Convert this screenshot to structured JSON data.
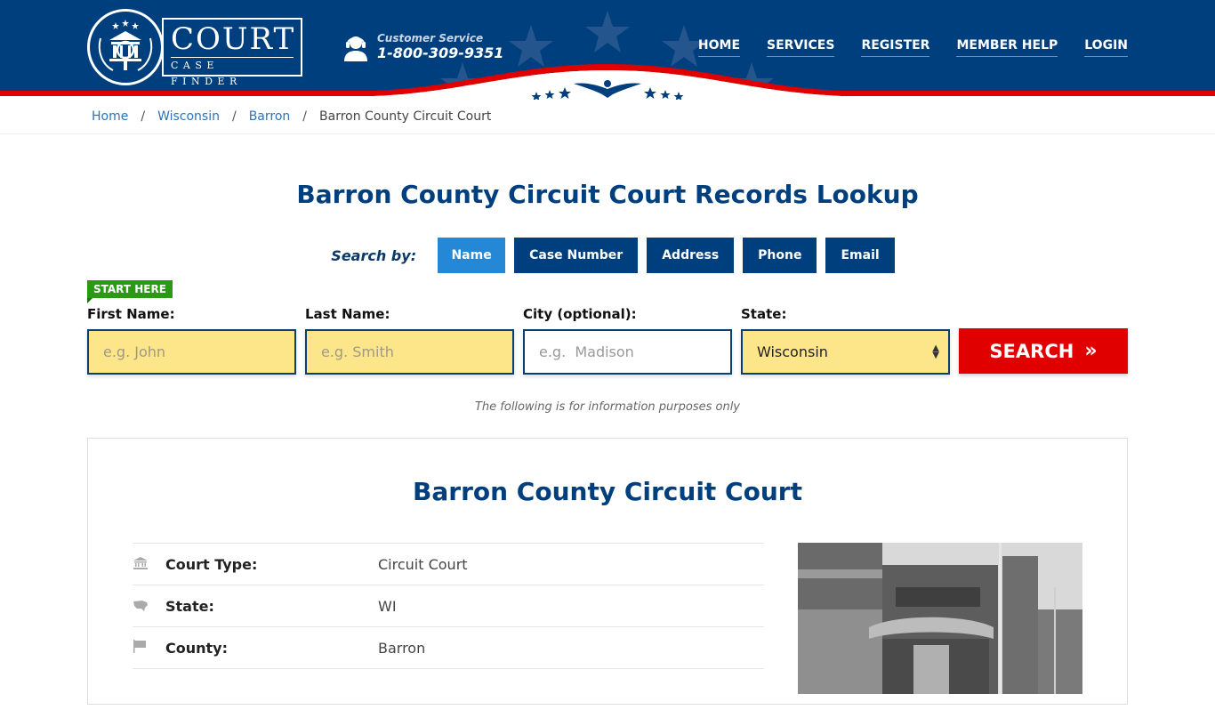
{
  "header": {
    "logo": {
      "title": "COURT",
      "subtitle": "CASE FINDER"
    },
    "customer_service": {
      "label": "Customer Service",
      "phone": "1-800-309-9351",
      "icon": "headset-agent-icon"
    },
    "nav": [
      {
        "label": "HOME"
      },
      {
        "label": "SERVICES"
      },
      {
        "label": "REGISTER"
      },
      {
        "label": "MEMBER HELP"
      },
      {
        "label": "LOGIN"
      }
    ]
  },
  "breadcrumb": [
    {
      "label": "Home",
      "link": true
    },
    {
      "label": "Wisconsin",
      "link": true
    },
    {
      "label": "Barron",
      "link": true
    },
    {
      "label": "Barron County Circuit Court",
      "link": false
    }
  ],
  "page_title": "Barron County Circuit Court Records Lookup",
  "search": {
    "search_by_label": "Search by:",
    "tabs": [
      {
        "label": "Name",
        "active": true
      },
      {
        "label": "Case Number",
        "active": false
      },
      {
        "label": "Address",
        "active": false
      },
      {
        "label": "Phone",
        "active": false
      },
      {
        "label": "Email",
        "active": false
      }
    ],
    "start_here": "START HERE",
    "fields": {
      "first_name": {
        "label": "First Name:",
        "placeholder": "e.g. John",
        "value": ""
      },
      "last_name": {
        "label": "Last Name:",
        "placeholder": "e.g. Smith",
        "value": ""
      },
      "city": {
        "label": "City (optional):",
        "placeholder": "e.g.  Madison",
        "value": ""
      },
      "state": {
        "label": "State:",
        "value": "Wisconsin"
      }
    },
    "button_label": "SEARCH",
    "disclaimer": "The following is for information purposes only"
  },
  "court": {
    "name": "Barron County Circuit Court",
    "details": [
      {
        "icon": "courthouse-icon",
        "key": "Court Type:",
        "value": "Circuit Court"
      },
      {
        "icon": "usa-map-icon",
        "key": "State:",
        "value": "WI"
      },
      {
        "icon": "flag-icon",
        "key": "County:",
        "value": "Barron"
      }
    ],
    "photo_alt": "Barron County Justice Center building"
  },
  "colors": {
    "brand_navy": "#003f7d",
    "accent_blue": "#2488d6",
    "search_red": "#e00000",
    "start_green": "#2a9a15",
    "input_yellow": "#fde68a"
  }
}
